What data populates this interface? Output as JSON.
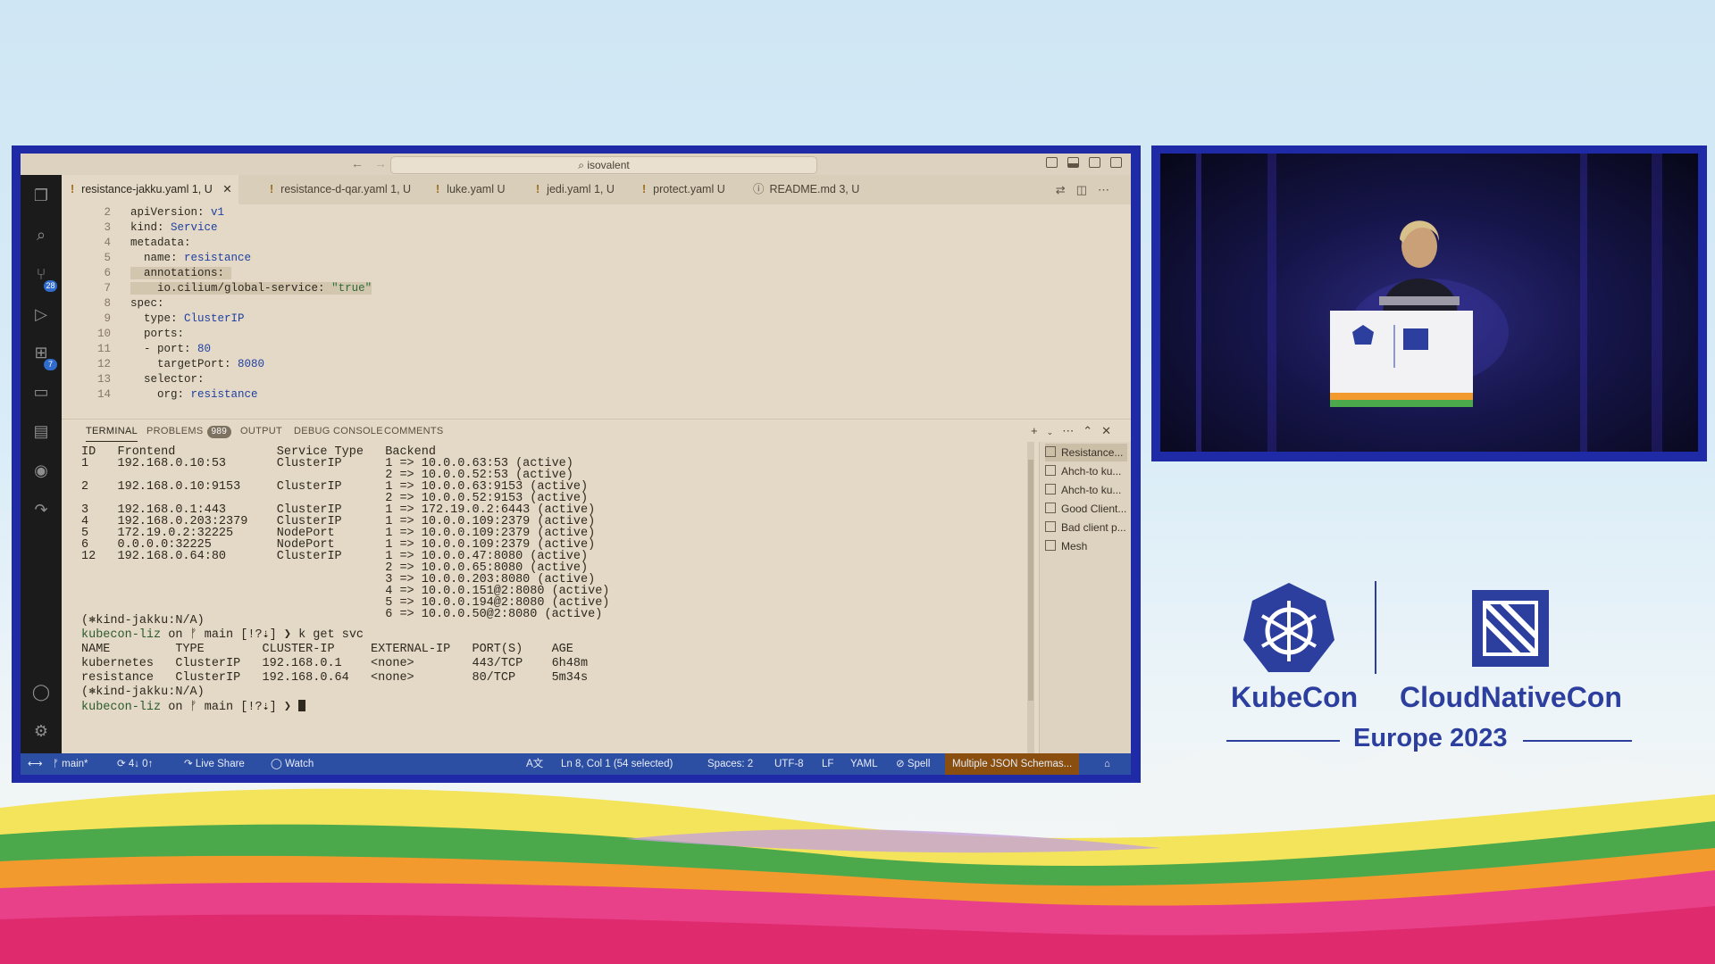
{
  "editor": {
    "command_center": "isovalent",
    "tabs": [
      {
        "label": "resistance-jakku.yaml",
        "status": "1, U",
        "active": true
      },
      {
        "label": "resistance-d-qar.yaml",
        "status": "1, U"
      },
      {
        "label": "luke.yaml",
        "status": "U"
      },
      {
        "label": "jedi.yaml",
        "status": "1, U"
      },
      {
        "label": "protect.yaml",
        "status": "U"
      },
      {
        "label": "README.md",
        "status": "3, U"
      }
    ],
    "activity_badges": {
      "source_control": "28",
      "extensions": "7"
    },
    "code": [
      {
        "n": "2",
        "key": "apiVersion:",
        "val": "v1"
      },
      {
        "n": "3",
        "key": "kind:",
        "val": "Service"
      },
      {
        "n": "4",
        "key": "metadata:",
        "val": ""
      },
      {
        "n": "5",
        "key": "  name:",
        "val": "resistance"
      },
      {
        "n": "6",
        "key": "  annotations:",
        "val": ""
      },
      {
        "n": "7",
        "key": "    io.cilium/global-service:",
        "val": "\"true\""
      },
      {
        "n": "8",
        "key": "spec:",
        "val": ""
      },
      {
        "n": "9",
        "key": "  type:",
        "val": "ClusterIP"
      },
      {
        "n": "10",
        "key": "  ports:",
        "val": ""
      },
      {
        "n": "11",
        "key": "  - port:",
        "val": "80"
      },
      {
        "n": "12",
        "key": "    targetPort:",
        "val": "8080"
      },
      {
        "n": "13",
        "key": "  selector:",
        "val": ""
      },
      {
        "n": "14",
        "key": "    org:",
        "val": "resistance"
      }
    ]
  },
  "panel": {
    "tabs": [
      "TERMINAL",
      "PROBLEMS",
      "OUTPUT",
      "DEBUG CONSOLE",
      "COMMENTS"
    ],
    "problems_count": "989"
  },
  "terminal": {
    "lines": [
      "ID   Frontend              Service Type   Backend",
      "1    192.168.0.10:53       ClusterIP      1 => 10.0.0.63:53 (active)",
      "                                          2 => 10.0.0.52:53 (active)",
      "2    192.168.0.10:9153     ClusterIP      1 => 10.0.0.63:9153 (active)",
      "                                          2 => 10.0.0.52:9153 (active)",
      "3    192.168.0.1:443       ClusterIP      1 => 172.19.0.2:6443 (active)",
      "4    192.168.0.203:2379    ClusterIP      1 => 10.0.0.109:2379 (active)",
      "5    172.19.0.2:32225      NodePort       1 => 10.0.0.109:2379 (active)",
      "6    0.0.0.0:32225         NodePort       1 => 10.0.0.109:2379 (active)",
      "12   192.168.0.64:80       ClusterIP      1 => 10.0.0.47:8080 (active)",
      "                                          2 => 10.0.0.65:8080 (active)",
      "                                          3 => 10.0.0.203:8080 (active)",
      "                                          4 => 10.0.0.151@2:8080 (active)",
      "                                          5 => 10.0.0.194@2:8080 (active)",
      "                                          6 => 10.0.0.50@2:8080 (active)"
    ],
    "ctx1": "(⎈kind-jakku:N/A)",
    "prompt1_host": "kubecon-liz",
    "prompt1_rest": " on ᚠ main [!?⇣] ❯ ",
    "command1": "k get svc",
    "svc_header": "NAME         TYPE        CLUSTER-IP     EXTERNAL-IP   PORT(S)    AGE",
    "svc_row1": "kubernetes   ClusterIP   192.168.0.1    <none>        443/TCP    6h48m",
    "svc_row2": "resistance   ClusterIP   192.168.0.64   <none>        80/TCP     5m34s",
    "ctx2": "(⎈kind-jakku:N/A)",
    "prompt2_host": "kubecon-liz",
    "prompt2_rest": " on ᚠ main [!?⇣] ❯ "
  },
  "terminal_list": [
    "Resistance...",
    "Ahch-to ku...",
    "Ahch-to ku...",
    "Good Client...",
    "Bad client p...",
    "Mesh"
  ],
  "statusbar": {
    "branch": "main*",
    "sync": "4↓ 0↑",
    "live_share": "Live Share",
    "watch": "Watch",
    "position": "Ln 8, Col 1 (54 selected)",
    "spaces": "Spaces: 2",
    "encoding": "UTF-8",
    "eol": "LF",
    "language": "YAML",
    "spell": "Spell",
    "schemas": "Multiple JSON Schemas..."
  },
  "conference": {
    "brand1": "KubeCon",
    "brand2": "CloudNativeCon",
    "edition": "Europe 2023",
    "colors": {
      "navy": "#2c3f9e",
      "frame": "#1f2aa6"
    }
  }
}
